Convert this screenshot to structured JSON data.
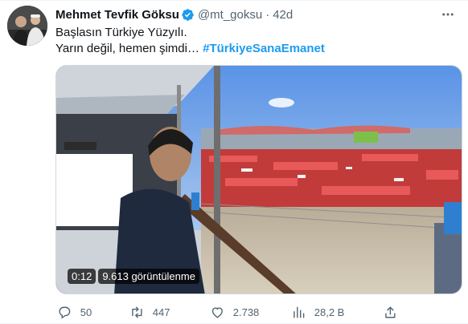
{
  "tweet": {
    "author": {
      "display_name": "Mehmet Tevfik Göksu",
      "handle": "@mt_goksu",
      "verified": true
    },
    "separator": "·",
    "time": "42d",
    "text_line1": "Başlasın Türkiye Yüzyılı.",
    "text_line2_prefix": "Yarın değil, hemen şimdi… ",
    "hashtag": "#TürkiyeSanaEmanet",
    "media": {
      "duration": "0:12",
      "views_label": "9.613 görüntülenme"
    },
    "actions": {
      "replies": "50",
      "retweets": "447",
      "likes": "2.738",
      "views": "28,2 B"
    }
  },
  "colors": {
    "accent": "#1d9bf0",
    "text_primary": "#0f1419",
    "text_secondary": "#536471"
  },
  "icons": {
    "verified": "verified-badge-icon",
    "more": "more-icon",
    "reply": "reply-icon",
    "retweet": "retweet-icon",
    "like": "heart-icon",
    "views": "views-bar-chart-icon",
    "share": "share-icon"
  }
}
